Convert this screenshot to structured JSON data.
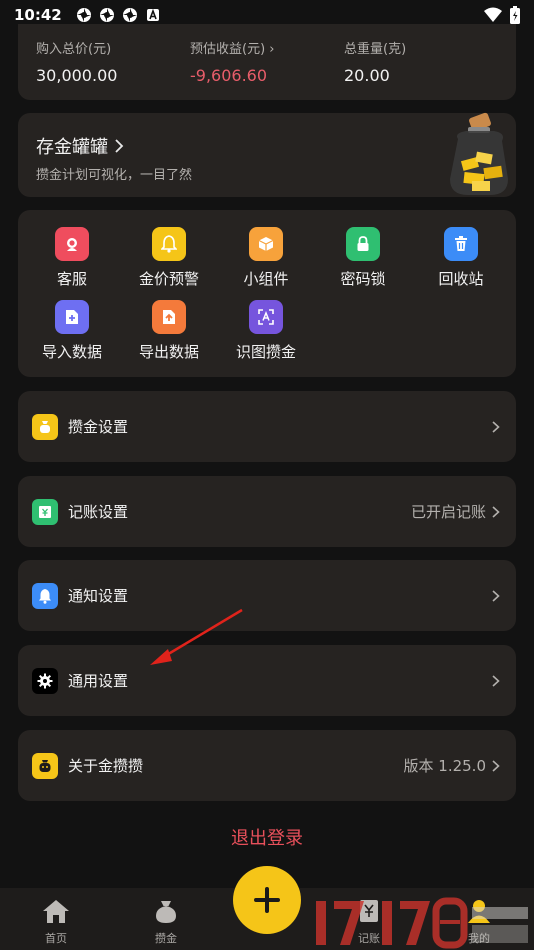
{
  "status_bar": {
    "time": "10:42"
  },
  "summary": [
    {
      "label": "购入总价(元)",
      "value": "30,000.00"
    },
    {
      "label": "预估收益(元) ›",
      "value": "-9,606.60"
    },
    {
      "label": "总重量(克)",
      "value": "20.00"
    }
  ],
  "jar": {
    "title": "存金罐罐",
    "subtitle": "攒金计划可视化，一目了然"
  },
  "tools": [
    {
      "label": "客服",
      "icon": "customer-service-icon",
      "color": "#ef4d5e"
    },
    {
      "label": "金价预警",
      "icon": "bell-icon",
      "color": "#f5c518"
    },
    {
      "label": "小组件",
      "icon": "cube-icon",
      "color": "#f7a23b"
    },
    {
      "label": "密码锁",
      "icon": "lock-icon",
      "color": "#2fbf71"
    },
    {
      "label": "回收站",
      "icon": "trash-icon",
      "color": "#3c8cf7"
    },
    {
      "label": "导入数据",
      "icon": "import-icon",
      "color": "#6e6ff2"
    },
    {
      "label": "导出数据",
      "icon": "export-icon",
      "color": "#f47a3b"
    },
    {
      "label": "识图攒金",
      "icon": "scan-icon",
      "color": "#7655dd"
    }
  ],
  "settings": [
    {
      "label": "攒金设置",
      "value": "",
      "icon": "gold-bag-icon",
      "color": "#f5c518"
    },
    {
      "label": "记账设置",
      "value": "已开启记账",
      "icon": "ledger-icon",
      "color": "#2fbf71"
    },
    {
      "label": "通知设置",
      "value": "",
      "icon": "bell-icon",
      "color": "#3c8cf7"
    },
    {
      "label": "通用设置",
      "value": "",
      "icon": "gear-icon",
      "color": "#000000"
    },
    {
      "label": "关于金攒攒",
      "value": "版本 1.25.0",
      "icon": "mascot-icon",
      "color": "#f5c518"
    }
  ],
  "logout_label": "退出登录",
  "tabs": [
    {
      "label": "首页",
      "icon": "home-icon"
    },
    {
      "label": "攒金",
      "icon": "money-bag-icon"
    },
    {
      "label": "记账",
      "icon": "ledger-icon"
    },
    {
      "label": "我的",
      "icon": "profile-icon"
    }
  ],
  "fab_icon": "plus-icon",
  "colors": {
    "accent": "#f5c518",
    "negative": "#e85d6a",
    "logout": "#e8505b",
    "card": "#262321",
    "background": "#121212"
  }
}
